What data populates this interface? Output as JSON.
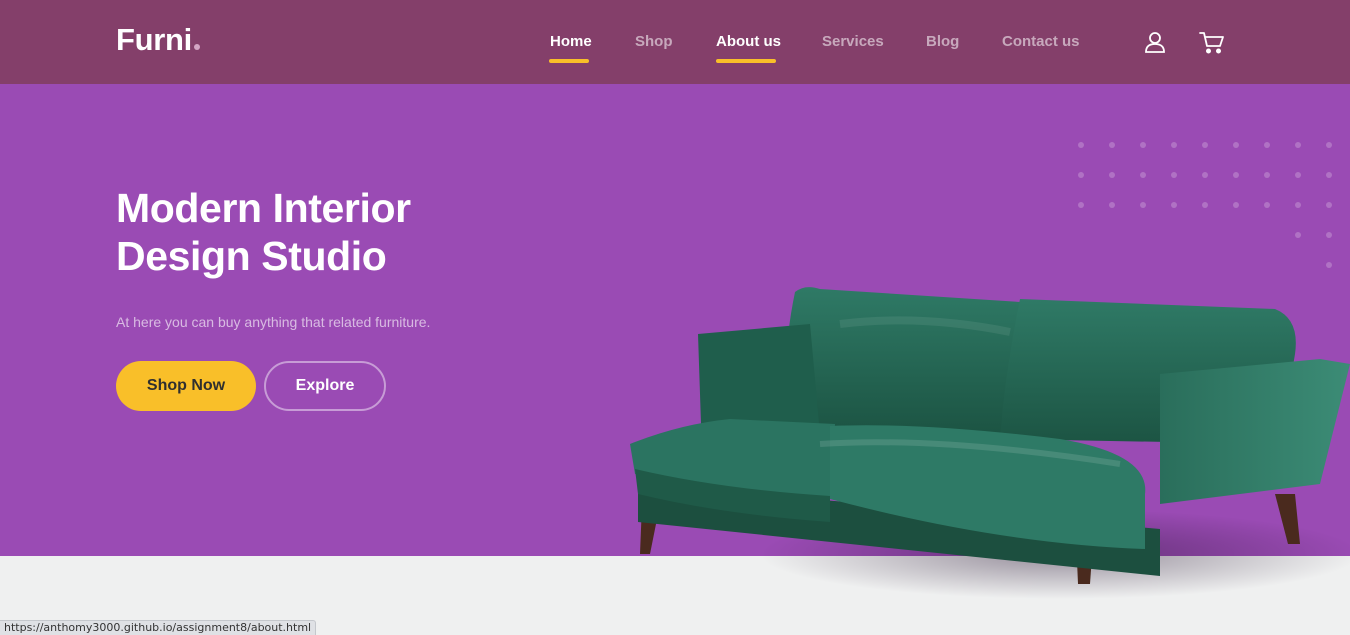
{
  "brand": {
    "name": "Furni",
    "accent": "#f9bf29",
    "nav_bg": "#843f6a",
    "hero_bg": "#9a4bb4"
  },
  "nav": {
    "items": [
      {
        "label": "Home",
        "active": true
      },
      {
        "label": "Shop",
        "active": false
      },
      {
        "label": "About us",
        "active": true
      },
      {
        "label": "Services",
        "active": false
      },
      {
        "label": "Blog",
        "active": false
      },
      {
        "label": "Contact us",
        "active": false
      }
    ],
    "icons": [
      "user-icon",
      "cart-icon"
    ]
  },
  "hero": {
    "title_line1": "Modern Interior",
    "title_line2": "Design Studio",
    "text": "At here you can buy anything that related furniture.",
    "primary_button": "Shop Now",
    "secondary_button": "Explore"
  },
  "status_bar": {
    "url": "https://anthomy3000.github.io/assignment8/about.html"
  }
}
